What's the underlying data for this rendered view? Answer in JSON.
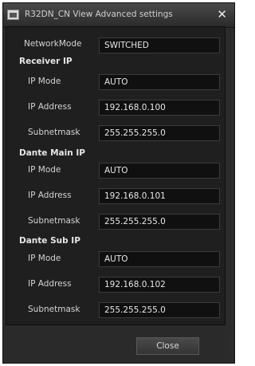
{
  "window": {
    "title": "R32DN_CN View Advanced settings",
    "close_symbol": "✕"
  },
  "network_mode": {
    "label": "NetworkMode",
    "value": "SWITCHED"
  },
  "receiver": {
    "heading": "Receiver IP",
    "ip_mode_label": "IP Mode",
    "ip_mode_value": "AUTO",
    "ip_address_label": "IP Address",
    "ip_address_value": "192.168.0.100",
    "subnet_label": "Subnetmask",
    "subnet_value": "255.255.255.0"
  },
  "dante_main": {
    "heading": "Dante Main IP",
    "ip_mode_label": "IP Mode",
    "ip_mode_value": "AUTO",
    "ip_address_label": "IP Address",
    "ip_address_value": "192.168.0.101",
    "subnet_label": "Subnetmask",
    "subnet_value": "255.255.255.0"
  },
  "dante_sub": {
    "heading": "Dante Sub IP",
    "ip_mode_label": "IP Mode",
    "ip_mode_value": "AUTO",
    "ip_address_label": "IP Address",
    "ip_address_value": "192.168.0.102",
    "subnet_label": "Subnetmask",
    "subnet_value": "255.255.255.0"
  },
  "footer": {
    "close_label": "Close"
  }
}
